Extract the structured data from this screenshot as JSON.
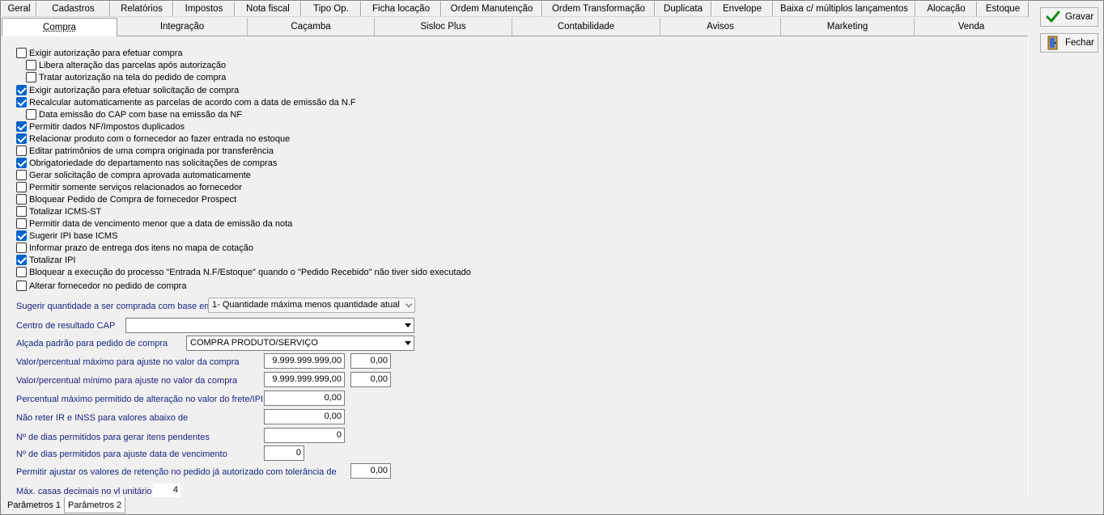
{
  "tabs_row1": [
    "Geral",
    "Cadastros",
    "Relatórios",
    "Impostos",
    "Nota fiscal",
    "Tipo Op.",
    "Ficha locação",
    "Ordem Manutenção",
    "Ordem Transformação",
    "Duplicata",
    "Envelope",
    "Baixa c/ múltiplos lançamentos",
    "Alocação",
    "Estoque"
  ],
  "tabs_row2": [
    "Compra",
    "Integração",
    "Caçamba",
    "Sisloc Plus",
    "Contabilidade",
    "Avisos",
    "Marketing",
    "Venda"
  ],
  "active_tab_row2": "Compra",
  "buttons": {
    "save": "Gravar",
    "close": "Fechar"
  },
  "checkboxes": [
    {
      "label": "Exigir autorização para efetuar compra",
      "checked": false
    },
    {
      "label": "Libera alteração das parcelas após autorização",
      "checked": false
    },
    {
      "label": "Tratar autorização na tela do pedido de compra",
      "checked": false
    },
    {
      "label": "Exigir autorização para efetuar solicitação de compra",
      "checked": true
    },
    {
      "label": "Recalcular automaticamente as parcelas de acordo com a data de emissão da N.F",
      "checked": true
    },
    {
      "label": "Data emissão do CAP com base na emissão da NF",
      "checked": false
    },
    {
      "label": "Permitir dados NF/Impostos duplicados",
      "checked": true
    },
    {
      "label": "Relacionar produto com o fornecedor ao fazer entrada no estoque",
      "checked": true
    },
    {
      "label": "Editar patrimônios de uma compra originada por transferência",
      "checked": false
    },
    {
      "label": "Obrigatoriedade do departamento nas solicitações de compras",
      "checked": true
    },
    {
      "label": "Gerar solicitação de compra aprovada automaticamente",
      "checked": false
    },
    {
      "label": "Permitir somente serviços relacionados ao fornecedor",
      "checked": false
    },
    {
      "label": "Bloquear Pedido de Compra de fornecedor Prospect",
      "checked": false
    },
    {
      "label": "Totalizar ICMS-ST",
      "checked": false
    },
    {
      "label": "Permitir data de vencimento menor que a data de emissão da nota",
      "checked": false
    },
    {
      "label": "Sugerir IPI base ICMS",
      "checked": true
    },
    {
      "label": "Informar prazo de entrega dos itens no mapa de cotação",
      "checked": false
    },
    {
      "label": "Totalizar IPI",
      "checked": true
    },
    {
      "label": "Bloquear a execução do processo \"Entrada N.F/Estoque\" quando o \"Pedido Recebido\" não tiver sido executado",
      "checked": false
    },
    {
      "label": "Alterar fornecedor no pedido de compra",
      "checked": false
    }
  ],
  "fields": {
    "sugerir_label": "Sugerir quantidade a ser comprada com base em",
    "sugerir_value": "1- Quantidade máxima menos quantidade atual",
    "centro_label": "Centro de resultado CAP",
    "centro_value": "",
    "alcada_label": "Alçada padrão para pedido de compra",
    "alcada_value": "COMPRA PRODUTO/SERVIÇO",
    "vmax_label": "Valor/percentual máximo para ajuste no valor da compra",
    "vmax_value": "9.999.999.999,00",
    "vmax_pct": "0,00",
    "vmin_label": "Valor/percentual mínimo para ajuste no valor da compra",
    "vmin_value": "9.999.999.999,00",
    "vmin_pct": "0,00",
    "frete_label": "Percentual máximo permitido de alteração no valor do frete/IPI",
    "frete_value": "0,00",
    "ir_label": "Não reter IR e INSS para valores abaixo de",
    "ir_value": "0,00",
    "dias_itens_label": "Nº de dias permitidos para gerar itens pendentes",
    "dias_itens_value": "0",
    "dias_venc_label": "Nº de dias permitidos para ajuste data de vencimento",
    "dias_venc_value": "0",
    "retencao_label": "Permitir ajustar os valores de retenção no pedido já autorizado com tolerância de",
    "retencao_value": "0,00",
    "casas_label": "Máx. casas decimais no vl unitário",
    "casas_value": "4"
  },
  "bottom_tabs": [
    "Parâmetros 1",
    "Parâmetros 2"
  ],
  "active_bottom_tab": "Parâmetros 2"
}
